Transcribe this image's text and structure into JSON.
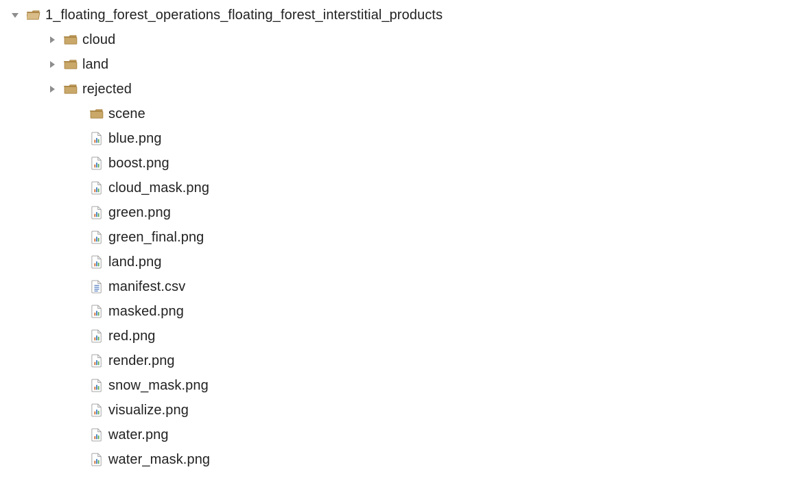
{
  "tree": {
    "root": {
      "name": "root-folder",
      "label": "1_floating_forest_operations_floating_forest_interstitial_products",
      "icon": "folder-open",
      "expanded": true,
      "indent": 0,
      "children": [
        {
          "name": "folder-cloud",
          "label": "cloud",
          "icon": "folder",
          "indent": 1,
          "expandable": true
        },
        {
          "name": "folder-land",
          "label": "land",
          "icon": "folder",
          "indent": 1,
          "expandable": true
        },
        {
          "name": "folder-rejected",
          "label": "rejected",
          "icon": "folder",
          "indent": 1,
          "expandable": true
        },
        {
          "name": "folder-scene",
          "label": "scene",
          "icon": "folder",
          "indent": 2,
          "expandable": false
        },
        {
          "name": "file-blue",
          "label": "blue.png",
          "icon": "image",
          "indent": 2
        },
        {
          "name": "file-boost",
          "label": "boost.png",
          "icon": "image",
          "indent": 2
        },
        {
          "name": "file-cloud-mask",
          "label": "cloud_mask.png",
          "icon": "image",
          "indent": 2
        },
        {
          "name": "file-green",
          "label": "green.png",
          "icon": "image",
          "indent": 2
        },
        {
          "name": "file-green-final",
          "label": "green_final.png",
          "icon": "image",
          "indent": 2
        },
        {
          "name": "file-land",
          "label": "land.png",
          "icon": "image",
          "indent": 2
        },
        {
          "name": "file-manifest",
          "label": "manifest.csv",
          "icon": "doc",
          "indent": 2
        },
        {
          "name": "file-masked",
          "label": "masked.png",
          "icon": "image",
          "indent": 2
        },
        {
          "name": "file-red",
          "label": "red.png",
          "icon": "image",
          "indent": 2
        },
        {
          "name": "file-render",
          "label": "render.png",
          "icon": "image",
          "indent": 2
        },
        {
          "name": "file-snow-mask",
          "label": "snow_mask.png",
          "icon": "image",
          "indent": 2
        },
        {
          "name": "file-visualize",
          "label": "visualize.png",
          "icon": "image",
          "indent": 2
        },
        {
          "name": "file-water",
          "label": "water.png",
          "icon": "image",
          "indent": 2
        },
        {
          "name": "file-water-mask",
          "label": "water_mask.png",
          "icon": "image",
          "indent": 2
        }
      ]
    }
  },
  "colors": {
    "folder_fill": "#c9a86a",
    "folder_stroke": "#a8813f",
    "page_stroke": "#9a9a9a",
    "page_fill": "#ffffff",
    "doc_lines": "#4e7bc0",
    "arrow": "#8e8e8e"
  }
}
